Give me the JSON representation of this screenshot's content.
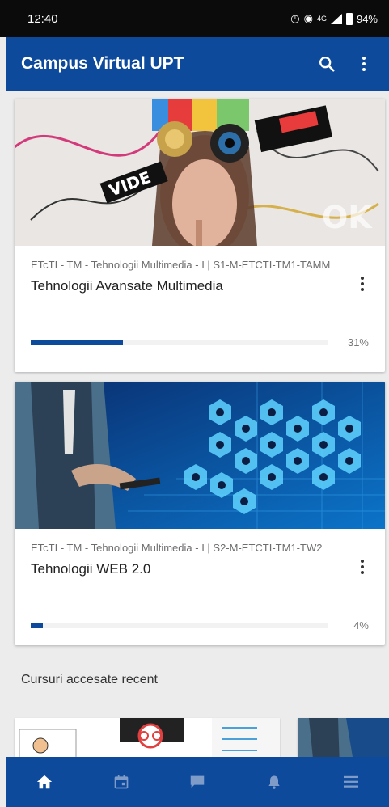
{
  "status_bar": {
    "time": "12:40",
    "network": "4G",
    "battery": "94%"
  },
  "app_bar": {
    "title": "Campus Virtual UPT",
    "search_icon": "search-icon",
    "menu_icon": "more-vert-icon"
  },
  "courses": [
    {
      "category": "ETcTI - TM - Tehnologii Multimedia - I | S1-M-ETCTI-TM1-TAMM",
      "title": "Tehnologii Avansate Multimedia",
      "progress": 31,
      "progress_text": "31%"
    },
    {
      "category": "ETcTI - TM - Tehnologii Multimedia - I | S2-M-ETCTI-TM1-TW2",
      "title": "Tehnologii WEB 2.0",
      "progress": 4,
      "progress_text": "4%"
    }
  ],
  "recent_section": {
    "title": "Cursuri accesate recent"
  },
  "bottom_nav": [
    "home-icon",
    "calendar-icon",
    "messages-icon",
    "notifications-icon",
    "menu-icon"
  ],
  "colors": {
    "primary": "#0d4a9c",
    "status_bar": "#0b0b0b",
    "background": "#ececec"
  }
}
